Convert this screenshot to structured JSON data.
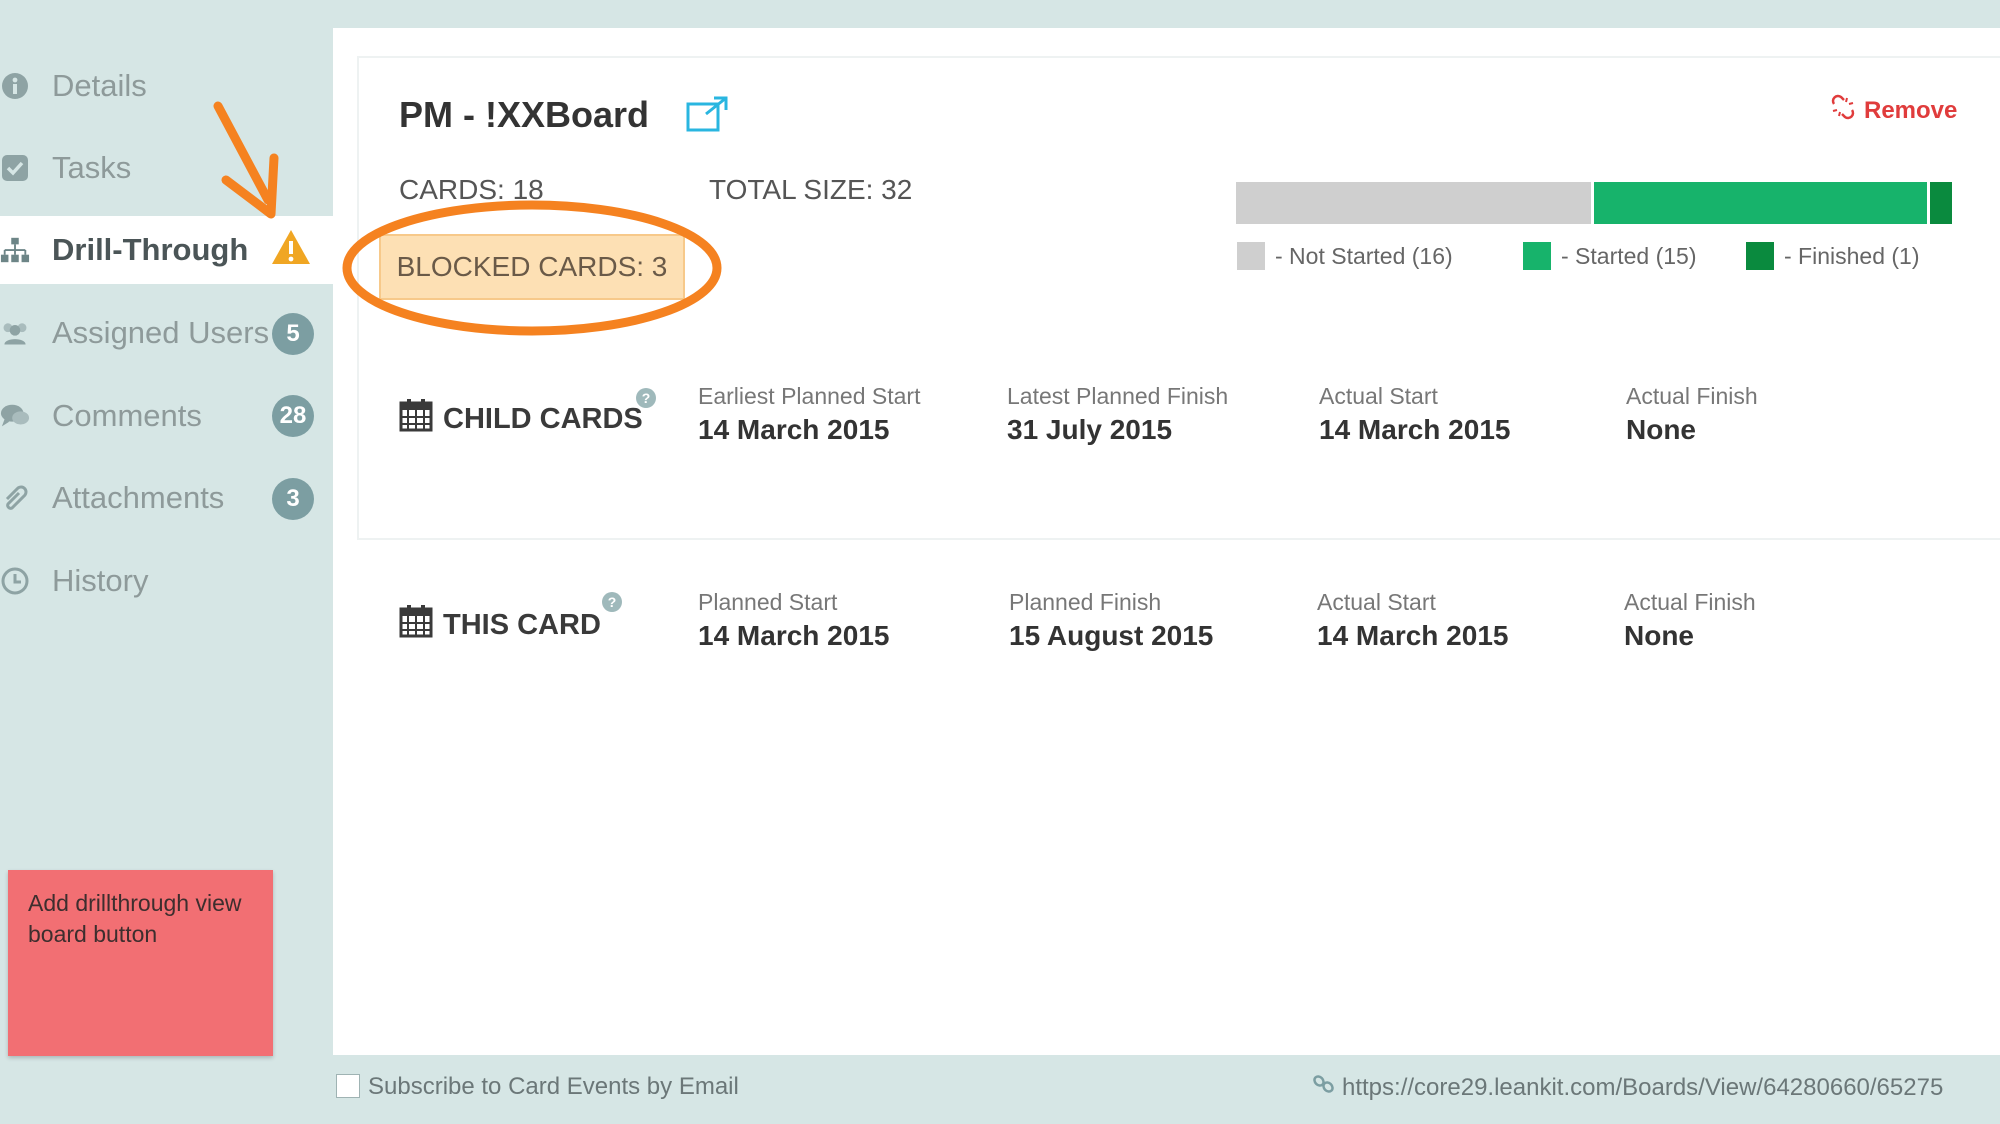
{
  "sidebar": {
    "items": [
      {
        "label": "Details",
        "icon": "info-icon"
      },
      {
        "label": "Tasks",
        "icon": "checkbox-icon"
      },
      {
        "label": "Drill-Through",
        "icon": "hierarchy-icon",
        "active": true
      },
      {
        "label": "Assigned Users",
        "icon": "users-icon",
        "badge": "5"
      },
      {
        "label": "Comments",
        "icon": "comments-icon",
        "badge": "28"
      },
      {
        "label": "Attachments",
        "icon": "paperclip-icon",
        "badge": "3"
      },
      {
        "label": "History",
        "icon": "clock-icon"
      }
    ]
  },
  "sticky_note": {
    "text": "Add drillthrough view board button"
  },
  "board": {
    "title": "PM - !XXBoard",
    "remove_label": "Remove",
    "cards": "CARDS: 18",
    "total_size": "TOTAL SIZE: 32",
    "blocked": "BLOCKED CARDS: 3"
  },
  "progress": {
    "segments": [
      {
        "name": "Not Started",
        "count": 16,
        "color": "#cfcfcf"
      },
      {
        "name": "Started",
        "count": 15,
        "color": "#17b36b"
      },
      {
        "name": "Finished",
        "count": 1,
        "color": "#0a8a3e"
      }
    ],
    "legend": [
      "- Not Started (16)",
      "- Started (15)",
      "- Finished (1)"
    ]
  },
  "child_cards": {
    "title": "CHILD CARDS",
    "columns": [
      {
        "label": "Earliest Planned Start",
        "value": "14 March 2015"
      },
      {
        "label": "Latest Planned Finish",
        "value": "31 July 2015"
      },
      {
        "label": "Actual Start",
        "value": "14 March 2015"
      },
      {
        "label": "Actual Finish",
        "value": "None"
      }
    ]
  },
  "this_card": {
    "title": "THIS CARD",
    "columns": [
      {
        "label": "Planned Start",
        "value": "14 March 2015"
      },
      {
        "label": "Planned Finish",
        "value": "15 August 2015"
      },
      {
        "label": "Actual Start",
        "value": "14 March 2015"
      },
      {
        "label": "Actual Finish",
        "value": "None"
      }
    ]
  },
  "footer": {
    "subscribe_label": "Subscribe to Card Events by Email",
    "url": "https://core29.leankit.com/Boards/View/64280660/65275"
  },
  "colors": {
    "accent": "#29b6e0",
    "remove": "#e03c3c",
    "annotation": "#f58220",
    "sticky": "#f26f73"
  }
}
